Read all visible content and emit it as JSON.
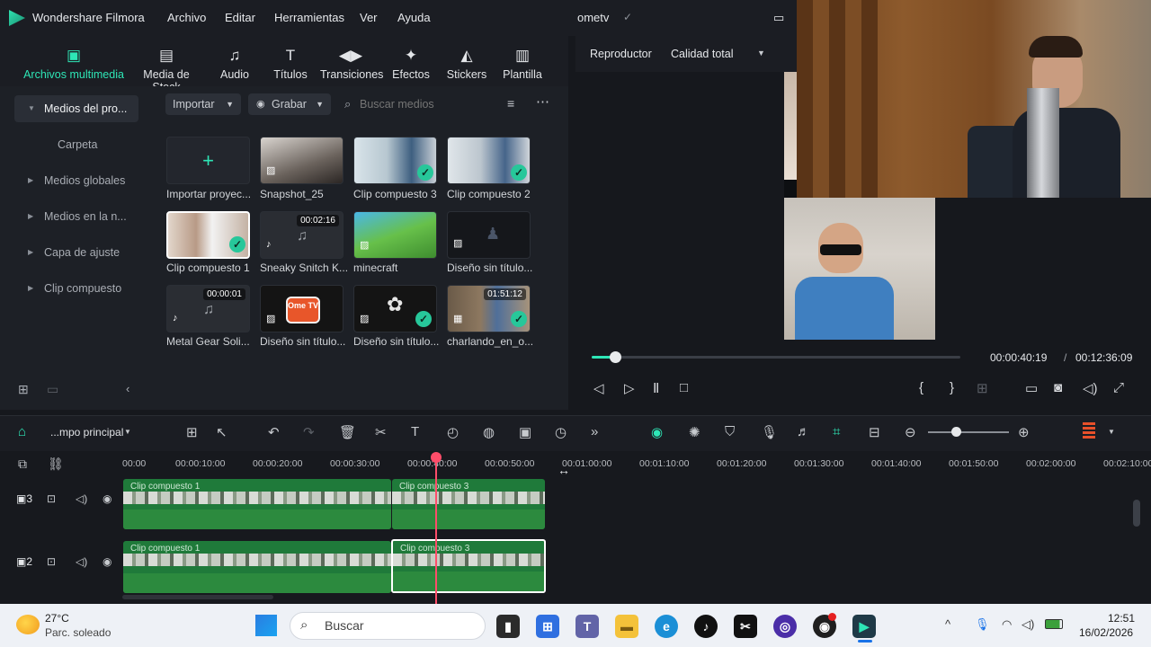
{
  "menu": {
    "app_name": "Wondershare Filmora",
    "items": [
      "Archivo",
      "Editar",
      "Herramientas",
      "Ver",
      "Ayuda"
    ],
    "project_name": "ometv"
  },
  "categories": [
    {
      "label": "Archivos multimedia",
      "icon": "media-icon"
    },
    {
      "label": "Media de Stock",
      "icon": "stock-media-icon"
    },
    {
      "label": "Audio",
      "icon": "music-note-icon"
    },
    {
      "label": "Títulos",
      "icon": "text-t-icon"
    },
    {
      "label": "Transiciones",
      "icon": "transition-icon"
    },
    {
      "label": "Efectos",
      "icon": "effects-sparkle-icon"
    },
    {
      "label": "Stickers",
      "icon": "sticker-icon"
    },
    {
      "label": "Plantilla",
      "icon": "template-icon"
    }
  ],
  "sidebar": {
    "items": [
      {
        "label": "Medios del pro...",
        "active": true
      },
      {
        "label": "Carpeta"
      },
      {
        "label": "Medios globales"
      },
      {
        "label": "Medios en la n..."
      },
      {
        "label": "Capa de ajuste"
      },
      {
        "label": "Clip compuesto"
      }
    ]
  },
  "media_toolbar": {
    "import_label": "Importar",
    "record_label": "Grabar",
    "search_placeholder": "Buscar medios"
  },
  "media_items": [
    {
      "label": "Importar proyec...",
      "kind": "import"
    },
    {
      "label": "Snapshot_25",
      "kind": "image"
    },
    {
      "label": "Clip compuesto 3",
      "kind": "video",
      "checked": true
    },
    {
      "label": "Clip compuesto 2",
      "kind": "video",
      "checked": true
    },
    {
      "label": "Clip compuesto 1",
      "kind": "video",
      "checked": true,
      "selected": true
    },
    {
      "label": "Sneaky Snitch K...",
      "kind": "audio",
      "duration": "00:02:16"
    },
    {
      "label": "minecraft",
      "kind": "image"
    },
    {
      "label": "Diseño sin título...",
      "kind": "image"
    },
    {
      "label": "Metal Gear Soli...",
      "kind": "audio",
      "duration": "00:00:01"
    },
    {
      "label": "Diseño sin título...",
      "kind": "image",
      "logo_text": "Ome TV"
    },
    {
      "label": "Diseño sin título...",
      "kind": "image",
      "checked": true
    },
    {
      "label": "charlando_en_o...",
      "kind": "video",
      "duration": "01:51:12",
      "checked": true
    }
  ],
  "player": {
    "tab_label": "Reproductor",
    "quality_label": "Calidad total",
    "current_time": "00:00:40:19",
    "separator": "/",
    "total_time": "00:12:36:09",
    "progress_fraction": 0.054
  },
  "timeline": {
    "timeline_name": "...mpo principal",
    "ruler": [
      "00:00",
      "00:00:10:00",
      "00:00:20:00",
      "00:00:30:00",
      "00:00:40:00",
      "00:00:50:00",
      "00:01:00:00",
      "00:01:10:00",
      "00:01:20:00",
      "00:01:30:00",
      "00:01:40:00",
      "00:01:50:00",
      "00:02:00:00",
      "00:02:10:00"
    ],
    "tracks": [
      {
        "number": "3",
        "clips": [
          "Clip compuesto 1",
          "Clip compuesto 3"
        ]
      },
      {
        "number": "2",
        "clips": [
          "Clip compuesto 1",
          "Clip compuesto 3"
        ]
      }
    ]
  },
  "taskbar": {
    "weather_temp": "27°C",
    "weather_desc": "Parc. soleado",
    "search_label": "Buscar",
    "time": "12:51",
    "date": "16/02/2026"
  },
  "colors": {
    "accent": "#2ee6b6",
    "playhead": "#ff4d6a",
    "clip_green": "#2c8a3e"
  }
}
